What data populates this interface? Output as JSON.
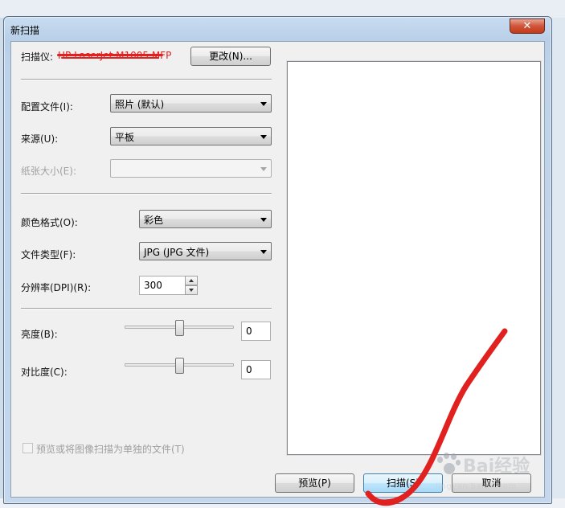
{
  "dialog": {
    "title": "新扫描",
    "close_label": "✕"
  },
  "scanner": {
    "label": "扫描仪:",
    "name": "HP LaserJet M1005 MFP",
    "change_button": "更改(N)..."
  },
  "profile": {
    "label": "配置文件(I):",
    "value": "照片 (默认)"
  },
  "source": {
    "label": "来源(U):",
    "value": "平板"
  },
  "paper_size": {
    "label": "纸张大小(E):",
    "value": ""
  },
  "color_format": {
    "label": "颜色格式(O):",
    "value": "彩色"
  },
  "file_type": {
    "label": "文件类型(F):",
    "value": "JPG (JPG 文件)"
  },
  "resolution": {
    "label": "分辨率(DPI)(R):",
    "value": "300"
  },
  "brightness": {
    "label": "亮度(B):",
    "value": "0",
    "level": 0.5
  },
  "contrast": {
    "label": "对比度(C):",
    "value": "0",
    "level": 0.5
  },
  "separate_files": {
    "label": "预览或将图像扫描为单独的文件(T)",
    "checked": false
  },
  "buttons": {
    "preview": "预览(P)",
    "scan": "扫描(S)",
    "cancel": "取消"
  },
  "watermark": {
    "text": "Bai经验",
    "url": "jingyan.baidu.com"
  },
  "colors": {
    "annotation": "#e12020",
    "accent": "#3c7fb1"
  }
}
